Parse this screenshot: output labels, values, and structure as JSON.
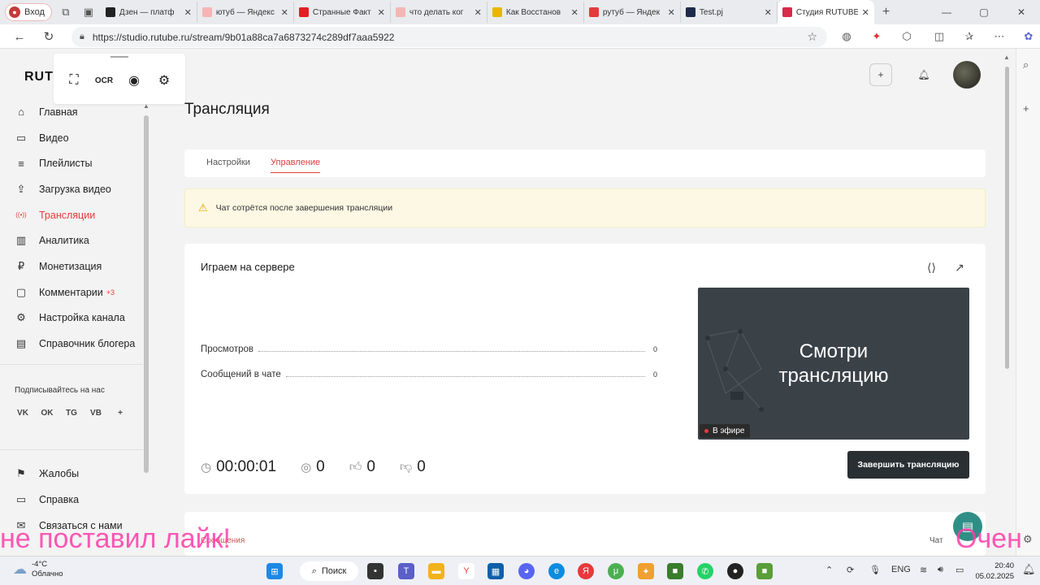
{
  "browser": {
    "profile_label": "Вход",
    "tabs": [
      {
        "title": "Дзен — платф",
        "color": "#222222"
      },
      {
        "title": "ютуб — Яндекс",
        "color": "#f5b5b5"
      },
      {
        "title": "Странные Факт",
        "color": "#e02020"
      },
      {
        "title": "что делать ког",
        "color": "#f5b5b5"
      },
      {
        "title": "Как Восстанов",
        "color": "#e6b800"
      },
      {
        "title": "рутуб — Яндек",
        "color": "#e53b3b"
      },
      {
        "title": "Test.pj",
        "color": "#1d2a4a"
      },
      {
        "title": "Студия RUTUBE",
        "color": "#d62b4a"
      }
    ],
    "url": "https://studio.rutube.ru/stream/9b01a88ca7a6873274c289df7aaa5922"
  },
  "sidebar": {
    "logo": "RUT",
    "items": [
      {
        "label": "Главная",
        "icon": "home-icon",
        "glyph": "⌂"
      },
      {
        "label": "Видео",
        "icon": "video-icon",
        "glyph": "▭"
      },
      {
        "label": "Плейлисты",
        "icon": "playlist-icon",
        "glyph": "≡"
      },
      {
        "label": "Загрузка видео",
        "icon": "upload-icon",
        "glyph": "⇪"
      },
      {
        "label": "Трансляции",
        "icon": "broadcast-icon",
        "glyph": "((•))"
      },
      {
        "label": "Аналитика",
        "icon": "analytics-icon",
        "glyph": "▥"
      },
      {
        "label": "Монетизация",
        "icon": "monetization-icon",
        "glyph": "₽"
      },
      {
        "label": "Комментарии",
        "icon": "comments-icon",
        "glyph": "▢",
        "badge": "+3"
      },
      {
        "label": "Настройка канала",
        "icon": "settings-icon",
        "glyph": "⚙"
      },
      {
        "label": "Справочник блогера",
        "icon": "book-icon",
        "glyph": "▤"
      }
    ],
    "active_index": 4,
    "subscribe_label": "Подписывайтесь на нас",
    "socials": [
      "VK",
      "OK",
      "TG",
      "VB",
      "+"
    ],
    "bottom_items": [
      {
        "label": "Жалобы",
        "icon": "flag-icon",
        "glyph": "⚑"
      },
      {
        "label": "Справка",
        "icon": "help-icon",
        "glyph": "▭"
      },
      {
        "label": "Связаться с нами",
        "icon": "mail-icon",
        "glyph": "✉"
      }
    ]
  },
  "page": {
    "title": "Трансляция",
    "tabs": [
      "Настройки",
      "Управление"
    ],
    "active_tab": 1,
    "warning": "Чат сотрётся после завершения трансляции",
    "stream": {
      "name": "Играем на сервере",
      "stats": [
        {
          "label": "Просмотров",
          "value": "0"
        },
        {
          "label": "Сообщений в чате",
          "value": "0"
        }
      ],
      "preview_text_1": "Смотри",
      "preview_text_2": "трансляцию",
      "live_label": "В эфире",
      "duration": "00:00:01",
      "viewers": "0",
      "likes": "0",
      "dislikes": "0",
      "end_button": "Завершить трансляцию"
    },
    "messages_label": "Сообщения",
    "chat_label": "Чат"
  },
  "overlay": {
    "left": "не поставил лайк!",
    "right": "Очен"
  },
  "taskbar": {
    "temperature": "-4°C",
    "weather": "Облачно",
    "search": "Поиск",
    "lang": "ENG",
    "time": "20:40",
    "date": "05.02.2025"
  },
  "colors": {
    "accent": "#e53b3b",
    "end_button": "#2a2f33",
    "warning_bg": "#fdf8e4",
    "preview_bg": "#3a4248"
  }
}
